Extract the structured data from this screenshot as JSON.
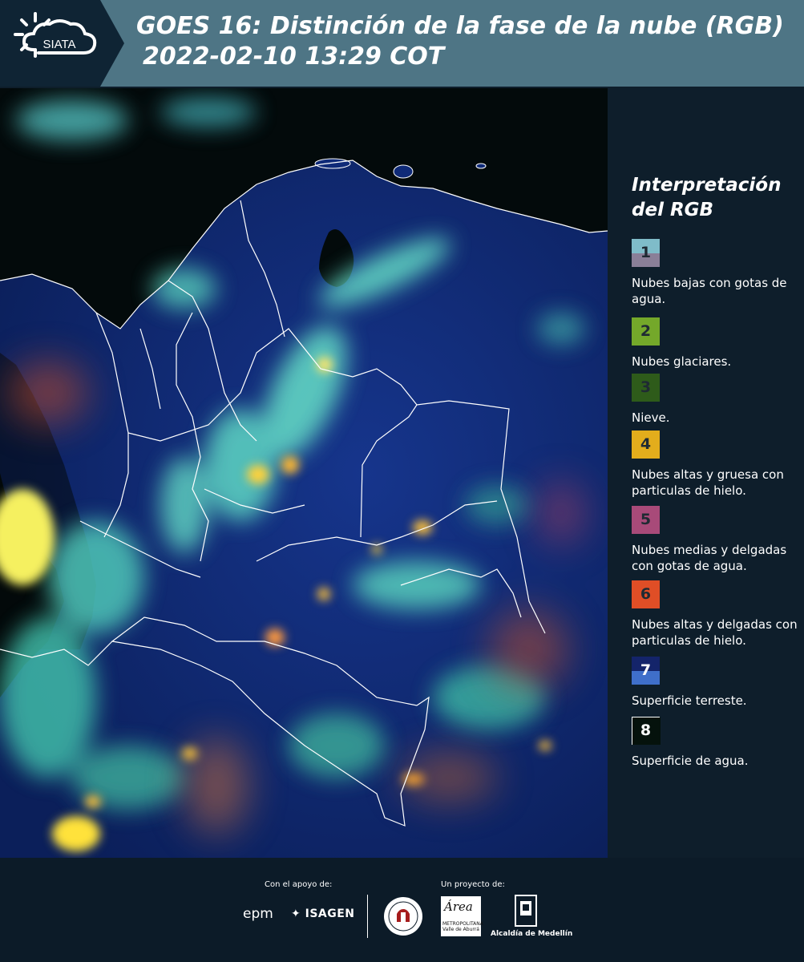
{
  "header": {
    "logo_text": "SIATA",
    "title_line1": "GOES 16: Distinción de la fase de la nube (RGB)",
    "title_line2": "2022-02-10 13:29 COT"
  },
  "legend": {
    "title_line1": "Interpretación",
    "title_line2": "del RGB",
    "items": [
      {
        "number": "1",
        "label": "Nubes bajas con gotas de agua.",
        "color_top": "#7fbcc9",
        "color_bottom": "#8a7f98"
      },
      {
        "number": "2",
        "label": "Nubes glaciares.",
        "color_top": "#74a82a",
        "color_bottom": "#74a82a"
      },
      {
        "number": "3",
        "label": "Nieve.",
        "color_top": "#2e5b1a",
        "color_bottom": "#2e5b1a"
      },
      {
        "number": "4",
        "label": "Nubes altas y gruesa con particulas de hielo.",
        "color_top": "#e3ad1c",
        "color_bottom": "#e3ad1c"
      },
      {
        "number": "5",
        "label": "Nubes medias y delgadas con gotas de agua.",
        "color_top": "#a84a79",
        "color_bottom": "#a84a79"
      },
      {
        "number": "6",
        "label": "Nubes altas y delgadas con particulas de hielo.",
        "color_top": "#e04e26",
        "color_bottom": "#e04e26"
      },
      {
        "number": "7",
        "label": "Superficie terreste.",
        "color_top": "#14246a",
        "color_bottom": "#3f6fca"
      },
      {
        "number": "8",
        "label": "Superficie de agua.",
        "color_top": "#05120c",
        "color_bottom": "#05120c"
      }
    ]
  },
  "footer": {
    "support_label": "Con el apoyo de:",
    "project_label": "Un proyecto de:",
    "sponsor_1": "epm",
    "sponsor_2": "ISAGEN",
    "partner_area_name": "Área",
    "partner_area_sub": "METROPOLITANA Valle de Aburrá",
    "partner_alcaldia": "Alcaldía de Medellín"
  },
  "colors": {
    "header_bg": "#4e7585",
    "page_bg": "#0e1e2b",
    "ocean": "#030a0b",
    "land": "#0f2a78",
    "cloud_low": "#7fe8d2",
    "cloud_high": "#ffd93a"
  }
}
